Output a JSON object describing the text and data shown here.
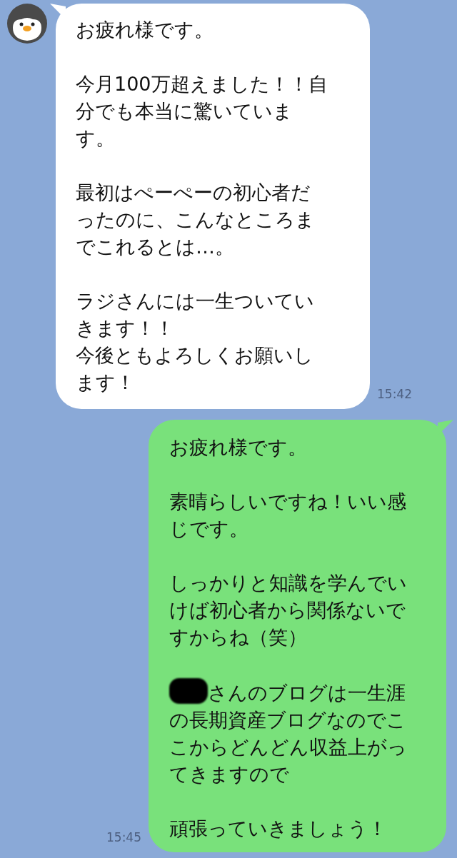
{
  "messages": [
    {
      "kind": "incoming",
      "time": "15:42",
      "paragraphs": [
        {
          "lines": [
            "お疲れ様です。"
          ]
        },
        {
          "lines": [
            "今月100万超えました！！自",
            "分でも本当に驚いていま",
            "す。"
          ]
        },
        {
          "lines": [
            "最初はぺーぺーの初心者だ",
            "ったのに、こんなところま",
            "でこれるとは…。"
          ]
        },
        {
          "lines": [
            "ラジさんには一生ついてい",
            "きます！！",
            "今後ともよろしくお願いし",
            "ます！"
          ]
        }
      ]
    },
    {
      "kind": "outgoing",
      "time": "15:45",
      "paragraphs": [
        {
          "lines": [
            "お疲れ様です。"
          ]
        },
        {
          "lines": [
            "素晴らしいですね！いい感",
            "じです。"
          ]
        },
        {
          "lines": [
            "しっかりと知識を学んでい",
            "けば初心者から関係ないで",
            "すからね（笑）"
          ]
        },
        {
          "redacted": true,
          "lines": [
            "さんのブログは一生涯",
            "の長期資産ブログなのでこ",
            "こからどんどん収益上がっ",
            "てきますので"
          ]
        },
        {
          "lines": [
            "頑張っていきましょう！"
          ]
        }
      ]
    }
  ]
}
